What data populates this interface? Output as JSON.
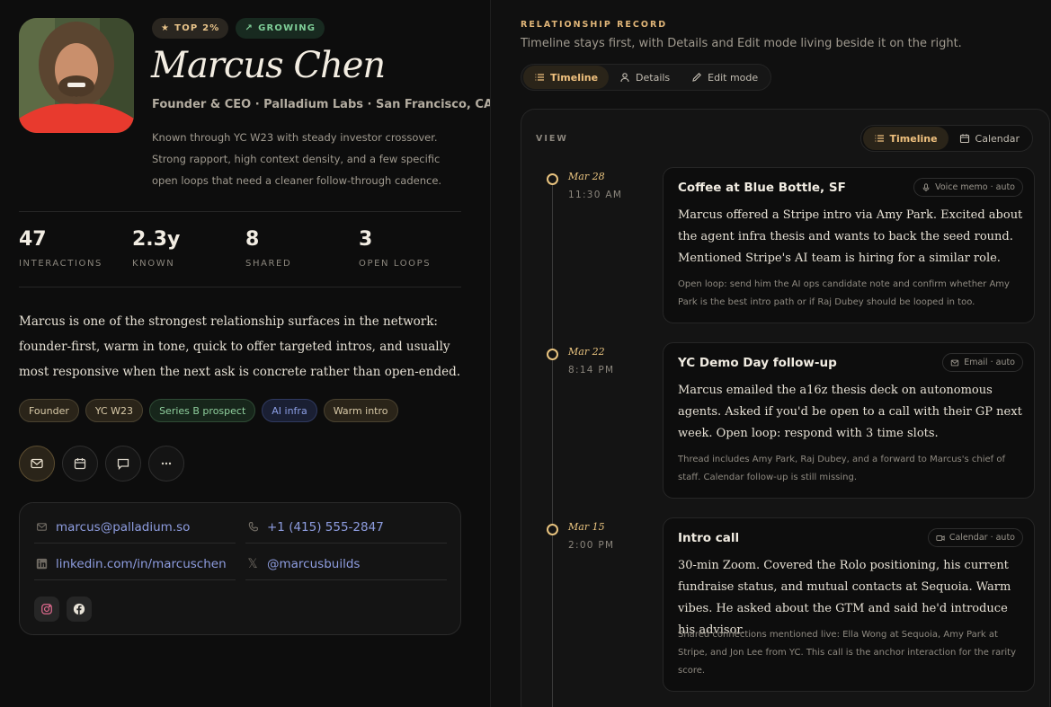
{
  "profile": {
    "badge_top": "TOP 2%",
    "badge_growing": "GROWING",
    "name": "Marcus Chen",
    "role": "Founder & CEO · Palladium Labs · San Francisco, CA",
    "description": "Known through YC W23 with steady investor crossover. Strong rapport, high context density, and a few specific open loops that need a cleaner follow-through cadence."
  },
  "stats": [
    {
      "value": "47",
      "label": "INTERACTIONS"
    },
    {
      "value": "2.3y",
      "label": "KNOWN"
    },
    {
      "value": "8",
      "label": "SHARED"
    },
    {
      "value": "3",
      "label": "OPEN LOOPS"
    }
  ],
  "summary": "Marcus is one of the strongest relationship surfaces in the network: founder-first, warm in tone, quick to offer targeted intros, and usually most responsive when the next ask is concrete rather than open-ended.",
  "tags": [
    "Founder",
    "YC W23",
    "Series B prospect",
    "AI infra",
    "Warm intro"
  ],
  "contact": {
    "email": "marcus@palladium.so",
    "phone": "+1 (415) 555-2847",
    "linkedin": "linkedin.com/in/marcuschen",
    "x_handle": "@marcusbuilds"
  },
  "record": {
    "label": "RELATIONSHIP RECORD",
    "subtitle": "Timeline stays first, with Details and Edit mode living beside it on the right.",
    "tabs": [
      "Timeline",
      "Details",
      "Edit mode"
    ],
    "view_label": "VIEW",
    "view_tabs": [
      "Timeline",
      "Calendar"
    ]
  },
  "events": [
    {
      "date": "Mar 28",
      "time": "11:30 AM",
      "title": "Coffee at Blue Bottle, SF",
      "source": "Voice memo · auto",
      "body": "Marcus offered a Stripe intro via Amy Park. Excited about the agent infra thesis and wants to back the seed round. Mentioned Stripe's AI team is hiring for a similar role.",
      "note": "Open loop: send him the AI ops candidate note and confirm whether Amy Park is the best intro path or if Raj Dubey should be looped in too."
    },
    {
      "date": "Mar 22",
      "time": "8:14 PM",
      "title": "YC Demo Day follow-up",
      "source": "Email · auto",
      "body": "Marcus emailed the a16z thesis deck on autonomous agents. Asked if you'd be open to a call with their GP next week. Open loop: respond with 3 time slots.",
      "note": "Thread includes Amy Park, Raj Dubey, and a forward to Marcus's chief of staff. Calendar follow-up is still missing."
    },
    {
      "date": "Mar 15",
      "time": "2:00 PM",
      "title": "Intro call",
      "source": "Calendar · auto",
      "body": "30-min Zoom. Covered the Rolo positioning, his current fundraise status, and mutual contacts at Sequoia. Warm vibes. He asked about the GTM and said he'd introduce his advisor.",
      "note": "Shared connections mentioned live: Ella Wong at Sequoia, Amy Park at Stripe, and Jon Lee from YC. This call is the anchor interaction for the rarity score."
    }
  ],
  "colors": {
    "accent": "#e8c37f",
    "link": "#8e9de0",
    "green": "#7fcf98"
  }
}
